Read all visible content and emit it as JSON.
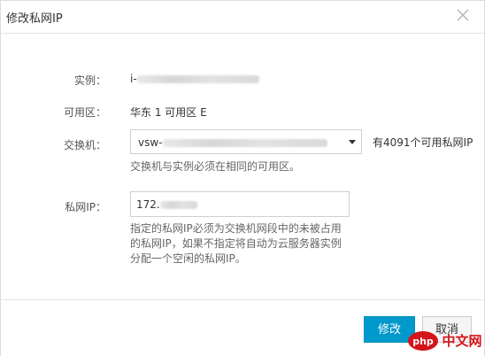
{
  "dialog": {
    "title": "修改私网IP"
  },
  "form": {
    "instance": {
      "label": "实例：",
      "value_prefix": "i-"
    },
    "zone": {
      "label": "可用区：",
      "value": "华东 1 可用区 E"
    },
    "vswitch": {
      "label": "交换机：",
      "value_prefix": "vsw-",
      "available": "有4091个可用私网IP",
      "hint": "交换机与实例必须在相同的可用区。"
    },
    "private_ip": {
      "label": "私网IP：",
      "value_prefix": "172.",
      "hint_lines": [
        "指定的私网IP必须为交换机网段中的未被占用",
        "的私网IP，如果不指定将自动为云服务器实例",
        "分配一个空闲的私网IP。"
      ]
    }
  },
  "buttons": {
    "confirm": "修改",
    "cancel": "取消"
  },
  "colors": {
    "primary": "#0099cc",
    "watermark_red": "#d4141a"
  }
}
